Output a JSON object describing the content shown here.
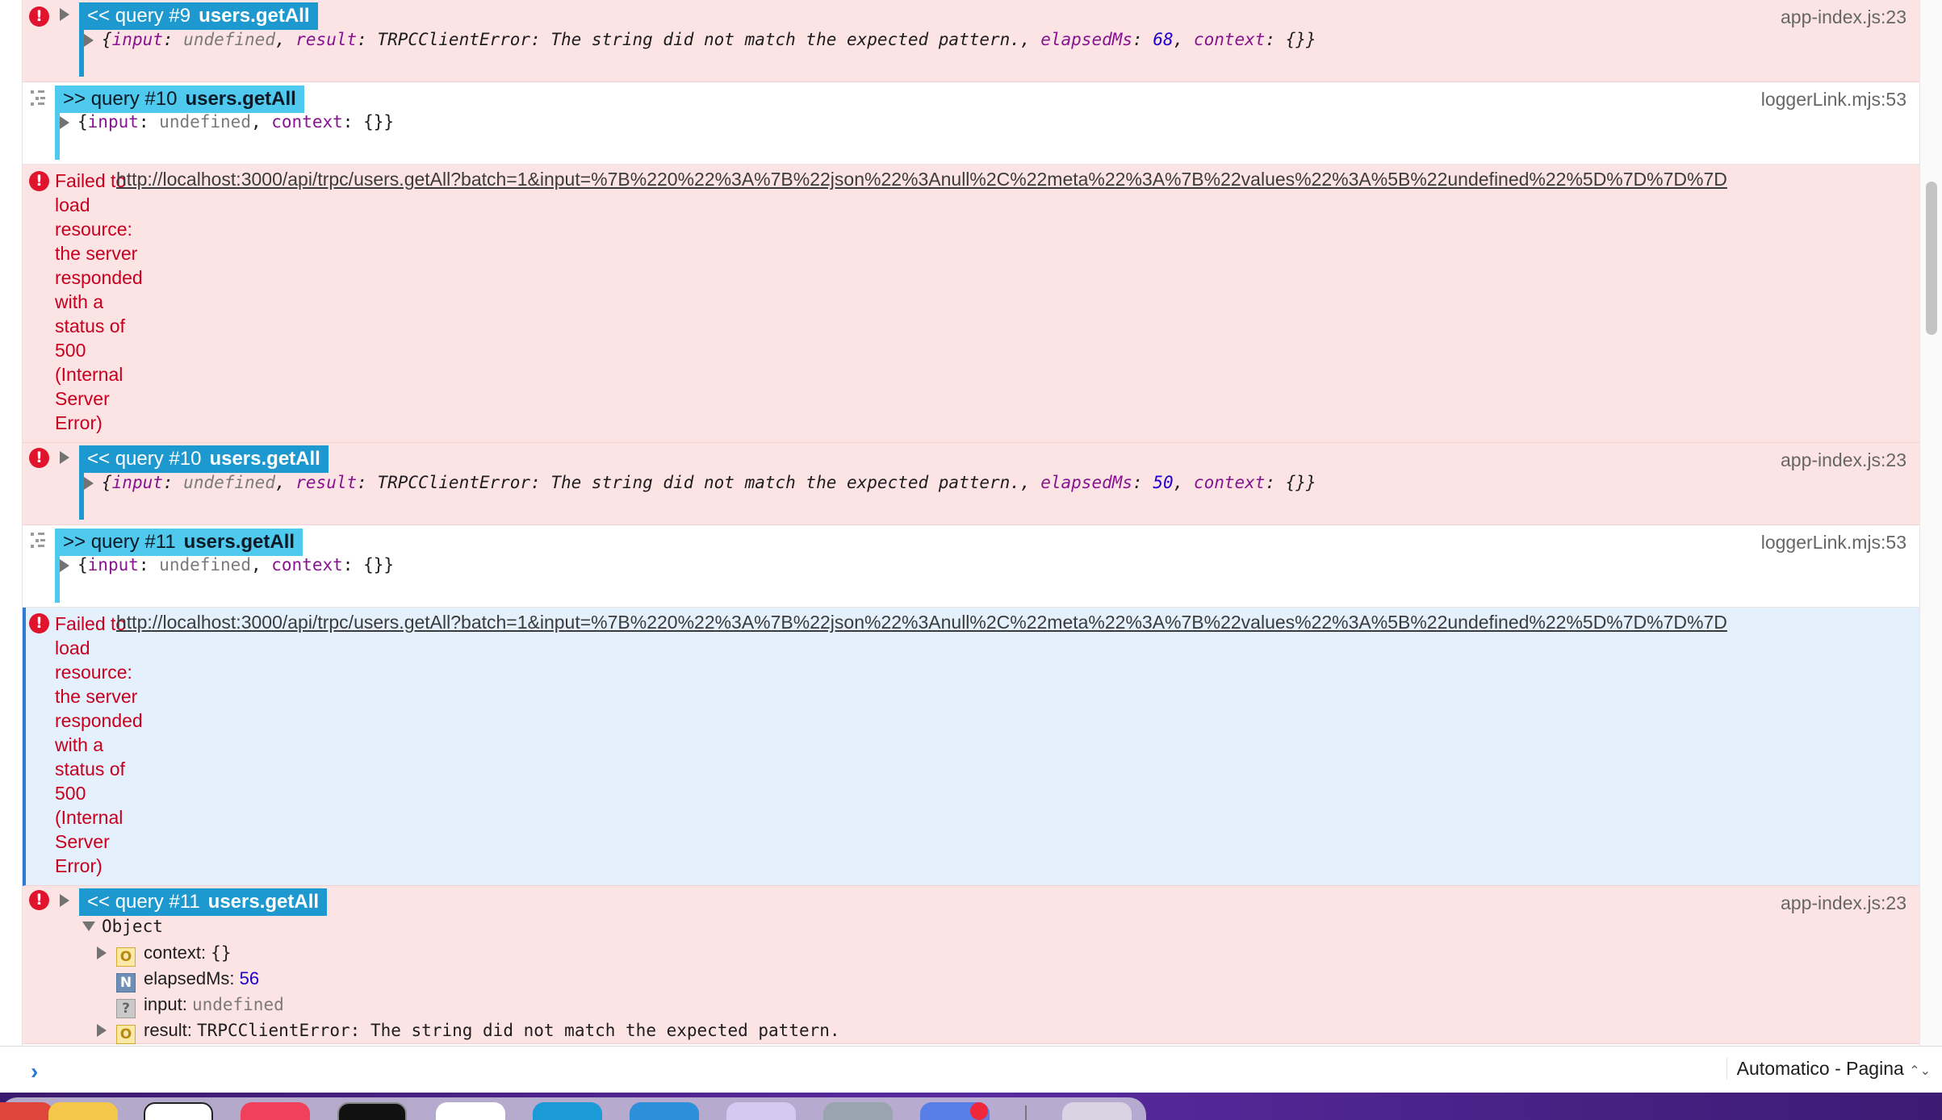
{
  "messages": [
    {
      "type": "error",
      "badge_prefix": "<< query #9",
      "badge_name": "users.getAll",
      "source": "app-index.js:23",
      "obj": {
        "k1": "input",
        "v1": "undefined",
        "k2": "result",
        "v2": "TRPCClientError: The string did not match the expected pattern.",
        "k3": "elapsedMs",
        "v3": "68",
        "k4": "context",
        "v4": "{}"
      }
    },
    {
      "type": "log",
      "badge_prefix": ">> query #10",
      "badge_name": "users.getAll",
      "source": "loggerLink.mjs:53",
      "obj": {
        "k1": "input",
        "v1": "undefined",
        "k2": "context",
        "v2": "{}"
      }
    },
    {
      "type": "failed",
      "text": "Failed to load resource: the server responded with a status of 500 (Internal Server Error)",
      "url": "http://localhost:3000/api/trpc/users.getAll?batch=1&input=%7B%220%22%3A%7B%22json%22%3Anull%2C%22meta%22%3A%7B%22values%22%3A%5B%22undefined%22%5D%7D%7D%7D"
    },
    {
      "type": "error",
      "badge_prefix": "<< query #10",
      "badge_name": "users.getAll",
      "source": "app-index.js:23",
      "obj": {
        "k1": "input",
        "v1": "undefined",
        "k2": "result",
        "v2": "TRPCClientError: The string did not match the expected pattern.",
        "k3": "elapsedMs",
        "v3": "50",
        "k4": "context",
        "v4": "{}"
      }
    },
    {
      "type": "log",
      "badge_prefix": ">> query #11",
      "badge_name": "users.getAll",
      "source": "loggerLink.mjs:53",
      "obj": {
        "k1": "input",
        "v1": "undefined",
        "k2": "context",
        "v2": "{}"
      }
    },
    {
      "type": "failed",
      "selected": true,
      "text": "Failed to load resource: the server responded with a status of 500 (Internal Server Error)",
      "url": "http://localhost:3000/api/trpc/users.getAll?batch=1&input=%7B%220%22%3A%7B%22json%22%3Anull%2C%22meta%22%3A%7B%22values%22%3A%5B%22undefined%22%5D%7D%7D%7D"
    },
    {
      "type": "error-expanded",
      "badge_prefix": "<< query #11",
      "badge_name": "users.getAll",
      "source": "app-index.js:23",
      "object_label": "Object",
      "props": [
        {
          "icon": "O",
          "key": "context",
          "value": "{}"
        },
        {
          "icon": "N",
          "key": "elapsedMs",
          "value": "56"
        },
        {
          "icon": "?",
          "key": "input",
          "value": "undefined"
        },
        {
          "icon": "O",
          "key": "result",
          "value": "TRPCClientError: The string did not match the expected pattern."
        }
      ]
    }
  ],
  "prompt": {
    "symbol": "›",
    "mode_label": "Automatico - Pagina",
    "mode_arrows": "⌃⌄"
  },
  "colors": {
    "error_bg": "#fde4e4",
    "badge_dark": "#1d99cf",
    "badge_light": "#4fc9ee",
    "selected_bg": "#e4f0fb",
    "error_text": "#c8001f"
  }
}
